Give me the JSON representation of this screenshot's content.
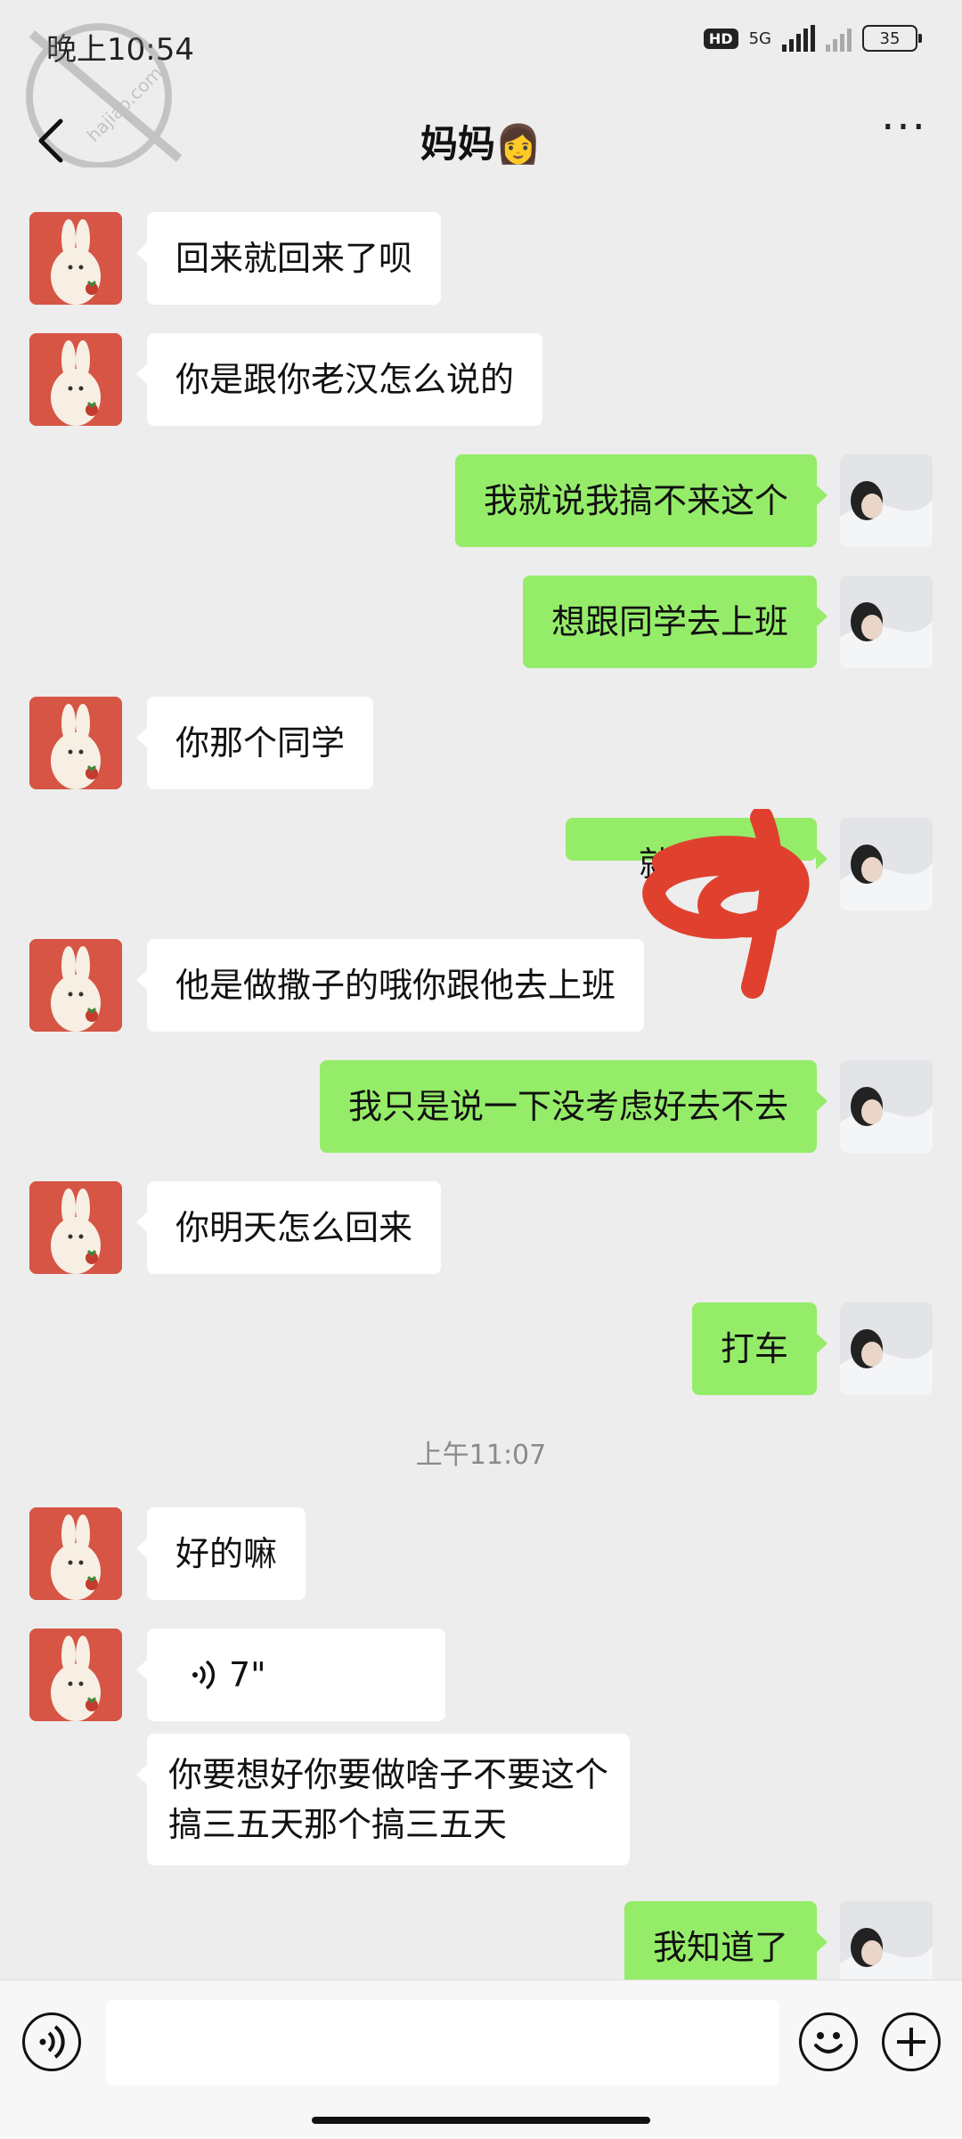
{
  "status_bar": {
    "time": "晚上10:54",
    "hd": "HD",
    "network": "5G",
    "battery": "35"
  },
  "watermark_text": "hajiao.com",
  "header": {
    "title": "妈妈👩"
  },
  "messages": [
    {
      "from": "other",
      "text": "回来就回来了呗"
    },
    {
      "from": "other",
      "text": "你是跟你老汉怎么说的"
    },
    {
      "from": "me",
      "text": "我就说我搞不来这个"
    },
    {
      "from": "me",
      "text": "想跟同学去上班"
    },
    {
      "from": "other",
      "text": "你那个同学"
    },
    {
      "from": "me",
      "text": "就"
    },
    {
      "from": "other",
      "text": "他是做撒子的哦你跟他去上班"
    },
    {
      "from": "me",
      "text": "我只是说一下没考虑好去不去"
    },
    {
      "from": "other",
      "text": "你明天怎么回来"
    },
    {
      "from": "me",
      "text": "打车"
    },
    {
      "from": "other",
      "text": "好的嘛"
    },
    {
      "from": "other",
      "voice_duration": "7\""
    },
    {
      "from": "other",
      "text": "你要想好你要做啥子不要这个\n搞三五天那个搞三五天"
    },
    {
      "from": "me",
      "text": "我知道了"
    }
  ],
  "timestamp": "上午11:07",
  "icons": {
    "back": "back-chevron-icon",
    "more": "more-icon",
    "voice": "voice-input-icon",
    "emoji": "emoji-icon",
    "plus": "plus-icon"
  }
}
